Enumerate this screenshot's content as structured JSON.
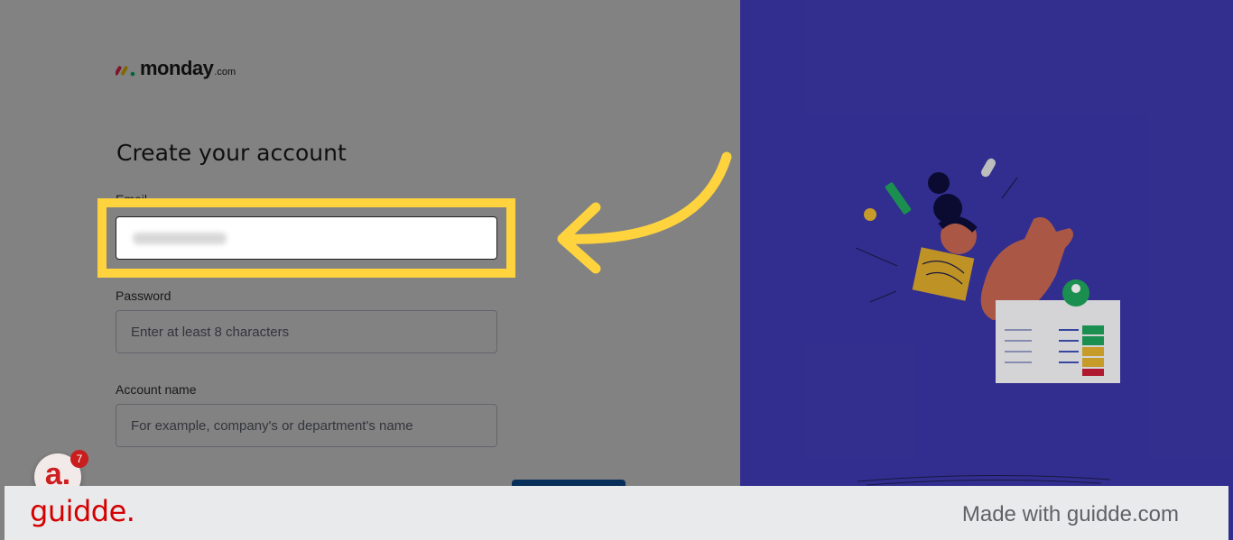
{
  "brand": {
    "word": "monday",
    "suffix": ".com"
  },
  "form": {
    "title": "Create your account",
    "email": {
      "label": "Email"
    },
    "password": {
      "label": "Password",
      "placeholder": "Enter at least 8 characters"
    },
    "account_name": {
      "label": "Account name",
      "placeholder": "For example, company's or department's name"
    }
  },
  "notifications": {
    "avatar_letter": "a.",
    "count": "7"
  },
  "footer": {
    "brand": "guidde.",
    "note": "Made with guidde.com"
  },
  "colors": {
    "highlight": "#ffd33d",
    "right_panel": "#3a35a3",
    "footer_brand": "#d40000"
  },
  "icons": [
    "monday-logo-icon",
    "pointer-arrow-icon",
    "signup-illustration"
  ]
}
